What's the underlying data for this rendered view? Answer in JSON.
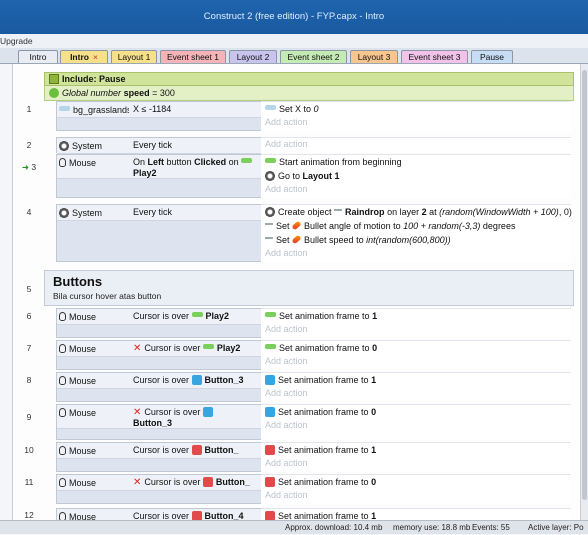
{
  "window": {
    "title": "Construct 2  (free edition) - FYP.capx - Intro"
  },
  "menu": {
    "label": "Upgrade"
  },
  "tabs": [
    {
      "label": "Intro",
      "color": "#e9edf3"
    },
    {
      "label": "Intro",
      "color": "#f6e08a",
      "close": "×"
    },
    {
      "label": "Layout 1",
      "color": "#f6e08a"
    },
    {
      "label": "Event sheet 1",
      "color": "#f3b3b7"
    },
    {
      "label": "Layout 2",
      "color": "#c9c4ee"
    },
    {
      "label": "Event sheet 2",
      "color": "#c5ebb4"
    },
    {
      "label": "Layout 3",
      "color": "#f7c58e"
    },
    {
      "label": "Event sheet 3",
      "color": "#f2c2ea"
    },
    {
      "label": "Pause",
      "color": "#c7dcf5"
    }
  ],
  "include": {
    "label": "Include: Pause"
  },
  "global": {
    "prefix": "Global number",
    "name": "speed",
    "value": "= 300"
  },
  "events": {
    "e1": {
      "num": "1",
      "obj": "bg_grasslands",
      "cond": "X ≤ -1184",
      "act1": "Set X to",
      "act1v": "0"
    },
    "e2": {
      "num": "2",
      "obj": "System",
      "cond": "Every tick"
    },
    "e3": {
      "num": "3",
      "obj": "Mouse",
      "cond_a": "On",
      "cond_b": "Left",
      "cond_c": "button",
      "cond_d": "Clicked",
      "cond_e": "on",
      "cond_f": "Play2",
      "act1": "Start animation from beginning",
      "act2a": "Go to",
      "act2b": "Layout 1"
    },
    "e4": {
      "num": "4",
      "obj": "System",
      "cond": "Every tick",
      "act1a": "Create object",
      "act1b": "Raindrop",
      "act1c": "on layer",
      "act1d": "2",
      "act1e": "at",
      "act1f": "(random(WindowWidth + 100)",
      "act1g": ", 0)",
      "act2a": "Set",
      "act2b": "Bullet angle of motion to",
      "act2c": "100 + random(-3,3)",
      "act2d": "degrees",
      "act3a": "Set",
      "act3b": "Bullet speed to",
      "act3c": "int(random(600,800))"
    },
    "e5": {
      "num": "5",
      "title": "Buttons",
      "desc": "Bila cursor hover atas button"
    },
    "e6": {
      "num": "6",
      "obj": "Mouse",
      "cond": "Cursor is over",
      "target": "Play2",
      "act": "Set animation frame to",
      "val": "1"
    },
    "e7": {
      "num": "7",
      "obj": "Mouse",
      "cond": "Cursor is over",
      "target": "Play2",
      "act": "Set animation frame to",
      "val": "0"
    },
    "e8": {
      "num": "8",
      "obj": "Mouse",
      "cond": "Cursor is over",
      "target": "Button_3",
      "act": "Set animation frame to",
      "val": "1"
    },
    "e9": {
      "num": "9",
      "obj": "Mouse",
      "cond": "Cursor is over",
      "target": "Button_3",
      "act": "Set animation frame to",
      "val": "0"
    },
    "e10": {
      "num": "10",
      "obj": "Mouse",
      "cond": "Cursor is over",
      "target": "Button_",
      "act": "Set animation frame to",
      "val": "1"
    },
    "e11": {
      "num": "11",
      "obj": "Mouse",
      "cond": "Cursor is over",
      "target": "Button_",
      "act": "Set animation frame to",
      "val": "0"
    },
    "e12": {
      "num": "12",
      "obj": "Mouse",
      "cond": "Cursor is over",
      "target": "Button_4",
      "act": "Set animation frame to",
      "val": "1"
    }
  },
  "add_action": "Add action",
  "status": {
    "download": "Approx. download: 10.4 mb",
    "memory": "memory use: 18.8 mb",
    "events": "Events: 55",
    "layer": "Active layer: Po"
  }
}
